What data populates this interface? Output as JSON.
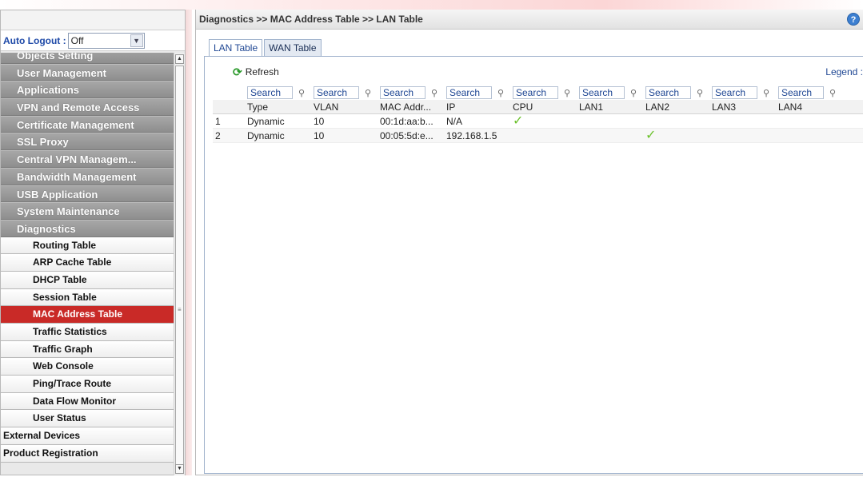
{
  "sidebar": {
    "autologout_label": "Auto Logout :",
    "autologout_value": "Off",
    "categories": [
      "Objects Setting",
      "User Management",
      "Applications",
      "VPN and Remote Access",
      "Certificate Management",
      "SSL Proxy",
      "Central VPN Managem...",
      "Bandwidth Management",
      "USB Application",
      "System Maintenance",
      "Diagnostics"
    ],
    "diagnostics_items": [
      "Routing Table",
      "ARP Cache Table",
      "DHCP Table",
      "Session Table",
      "MAC Address Table",
      "Traffic Statistics",
      "Traffic Graph",
      "Web Console",
      "Ping/Trace Route",
      "Data Flow Monitor",
      "User Status"
    ],
    "active_item": "MAC Address Table",
    "bottom_items": [
      "External Devices",
      "Product Registration"
    ]
  },
  "header": {
    "breadcrumb": "Diagnostics >> MAC Address Table >> LAN Table",
    "help_symbol": "?"
  },
  "tabs": [
    "LAN Table",
    "WAN Table"
  ],
  "active_tab": "LAN Table",
  "toolbar": {
    "refresh_label": "Refresh",
    "legend_label": "Legend :"
  },
  "table": {
    "search_placeholder": "Search",
    "columns": [
      "Type",
      "VLAN",
      "MAC Addr...",
      "IP",
      "CPU",
      "LAN1",
      "LAN2",
      "LAN3",
      "LAN4"
    ],
    "rows": [
      [
        "1",
        "Dynamic",
        "10",
        "00:1d:aa:b...",
        "N/A",
        "✓",
        "",
        "",
        "",
        ""
      ],
      [
        "2",
        "Dynamic",
        "10",
        "00:05:5d:e...",
        "192.168.1.5",
        "",
        "",
        "✓",
        "",
        ""
      ]
    ]
  },
  "colors": {
    "active_menu": "#c92a27",
    "category_bg": "#999999",
    "link_blue": "#1e4693",
    "check_green": "#6bc12b"
  }
}
